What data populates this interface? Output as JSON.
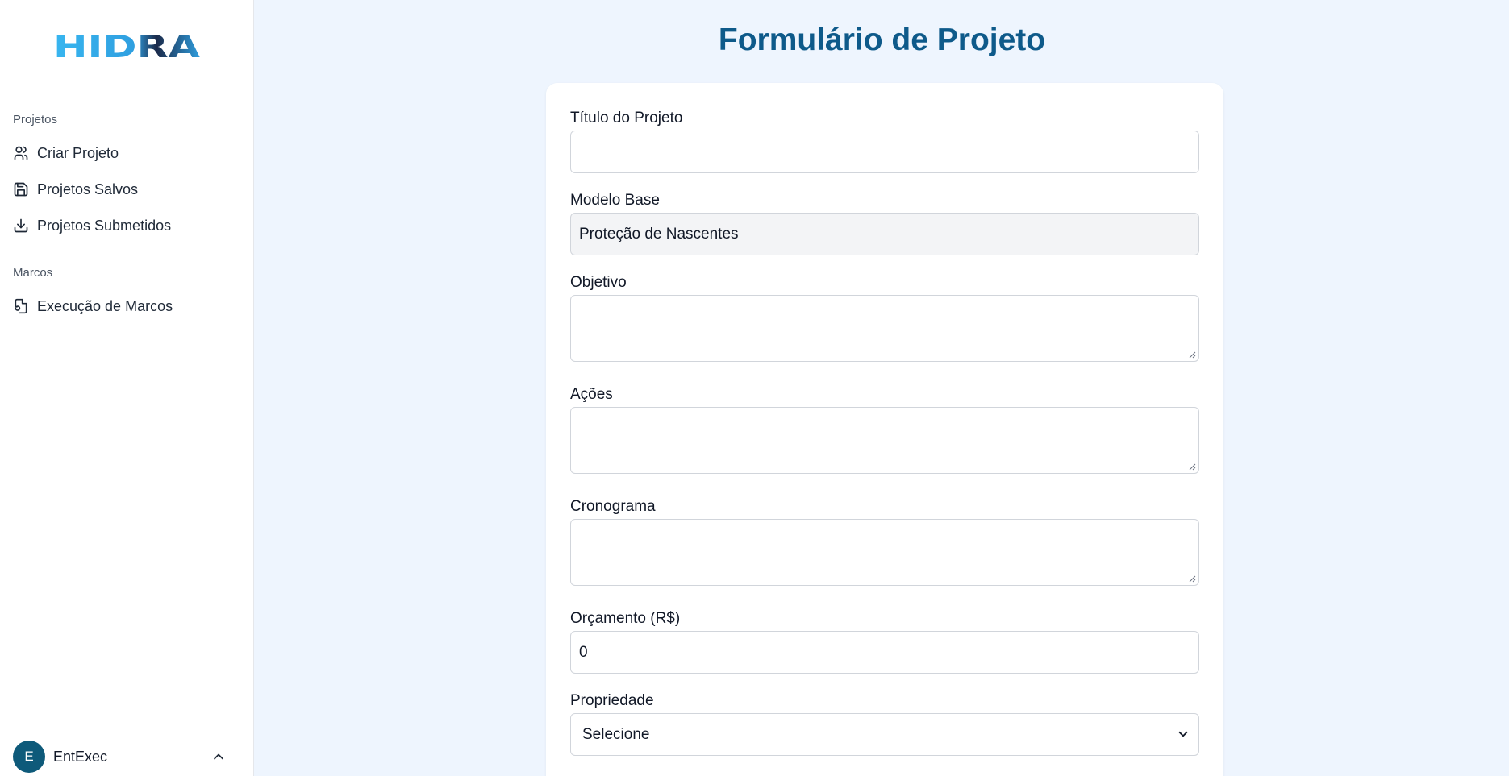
{
  "app": {
    "logo_text": "HIDRA"
  },
  "sidebar": {
    "sections": [
      {
        "label": "Projetos"
      },
      {
        "label": "Marcos"
      }
    ],
    "items": [
      {
        "label": "Criar Projeto",
        "icon": "users-icon"
      },
      {
        "label": "Projetos Salvos",
        "icon": "save-icon"
      },
      {
        "label": "Projetos Submetidos",
        "icon": "download-icon"
      },
      {
        "label": "Execução de Marcos",
        "icon": "file-refresh-icon"
      }
    ],
    "user": {
      "initial": "E",
      "name": "EntExec"
    }
  },
  "main": {
    "title": "Formulário de Projeto",
    "form": {
      "titulo_label": "Título do Projeto",
      "titulo_value": "",
      "modelo_label": "Modelo Base",
      "modelo_value": "Proteção de Nascentes",
      "objetivo_label": "Objetivo",
      "acoes_label": "Ações",
      "cronograma_label": "Cronograma",
      "orcamento_label": "Orçamento (R$)",
      "orcamento_value": "0",
      "propriedade_label": "Propriedade",
      "propriedade_value": "Selecione"
    }
  },
  "colors": {
    "accent": "#0e5a8a",
    "background": "#eef5fe",
    "avatar": "#0e5a7a"
  }
}
